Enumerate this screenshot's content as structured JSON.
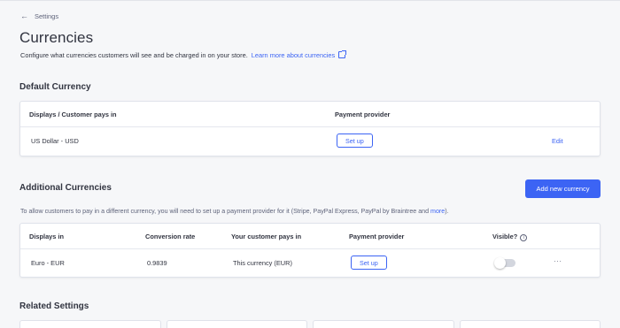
{
  "breadcrumb": {
    "back_label": "Settings"
  },
  "page": {
    "title": "Currencies",
    "subtitle": "Configure what currencies customers will see and be charged in on your store.",
    "learn_more": "Learn more about currencies"
  },
  "default_currency": {
    "title": "Default Currency",
    "headers": {
      "displays": "Displays / Customer pays in",
      "provider": "Payment provider"
    },
    "row": {
      "currency": "US Dollar - USD",
      "setup_label": "Set up",
      "edit_label": "Edit"
    }
  },
  "additional_currencies": {
    "title": "Additional Currencies",
    "add_button": "Add new currency",
    "info_text": "To allow customers to pay in a different currency, you will need to set up a payment provider for it (Stripe, PayPal Express, PayPal by Braintree and",
    "info_link": "more",
    "info_end": ").",
    "headers": {
      "displays": "Displays in",
      "rate": "Conversion rate",
      "pays": "Your customer pays in",
      "provider": "Payment provider",
      "visible": "Visible?"
    },
    "row": {
      "currency": "Euro - EUR",
      "rate": "0.9839",
      "pays": "This currency (EUR)",
      "setup_label": "Set up",
      "visible": false,
      "more_label": "···"
    }
  },
  "related": {
    "title": "Related Settings"
  },
  "icons": {
    "back": "arrow-left-icon",
    "external": "external-link-icon",
    "info": "info-circle-icon",
    "more": "more-horizontal-icon"
  },
  "colors": {
    "accent": "#3c64f4",
    "background": "#f6f7f9",
    "text": "#313440",
    "muted": "#5e637a"
  }
}
